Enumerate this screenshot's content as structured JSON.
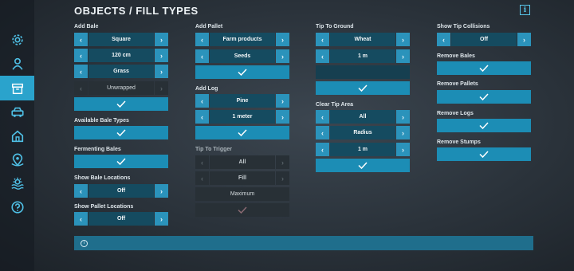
{
  "page_title": "OBJECTS / FILL TYPES",
  "sidebar_icons": [
    "gear-icon",
    "user-icon",
    "box-icon",
    "vehicle-icon",
    "home-icon",
    "map-pin-icon",
    "weather-icon",
    "help-icon"
  ],
  "col1": {
    "add_bale": {
      "title": "Add Bale",
      "shape": "Square",
      "size": "120 cm",
      "filltype": "Grass",
      "wrap": "Unwrapped"
    },
    "available_bale_types": "Available Bale Types",
    "fermenting_bales": "Fermenting Bales",
    "show_bale_locations": {
      "title": "Show Bale Locations",
      "value": "Off"
    },
    "show_pallet_locations": {
      "title": "Show Pallet Locations",
      "value": "Off"
    }
  },
  "col2": {
    "add_pallet": {
      "title": "Add Pallet",
      "category": "Farm products",
      "item": "Seeds"
    },
    "add_log": {
      "title": "Add Log",
      "type": "Pine",
      "length": "1 meter"
    },
    "tip_to_trigger": {
      "title": "Tip To Trigger",
      "target": "All",
      "mode": "Fill",
      "amount": "Maximum"
    }
  },
  "col3": {
    "tip_to_ground": {
      "title": "Tip To Ground",
      "filltype": "Wheat",
      "amount": "1 m"
    },
    "clear_tip_area": {
      "title": "Clear Tip Area",
      "filltype": "All",
      "shape": "Radius",
      "size": "1 m"
    }
  },
  "col4": {
    "show_tip_collisions": {
      "title": "Show Tip Collisions",
      "value": "Off"
    },
    "remove_bales": "Remove Bales",
    "remove_pallets": "Remove Pallets",
    "remove_logs": "Remove Logs",
    "remove_stumps": "Remove Stumps"
  },
  "glyphs": {
    "left": "‹",
    "right": "›",
    "info": "i",
    "status_info": "i"
  },
  "colors": {
    "accent": "#2aa3cc",
    "button": "#1c8db5",
    "value_bg": "#154b60",
    "disabled": "#283036"
  }
}
